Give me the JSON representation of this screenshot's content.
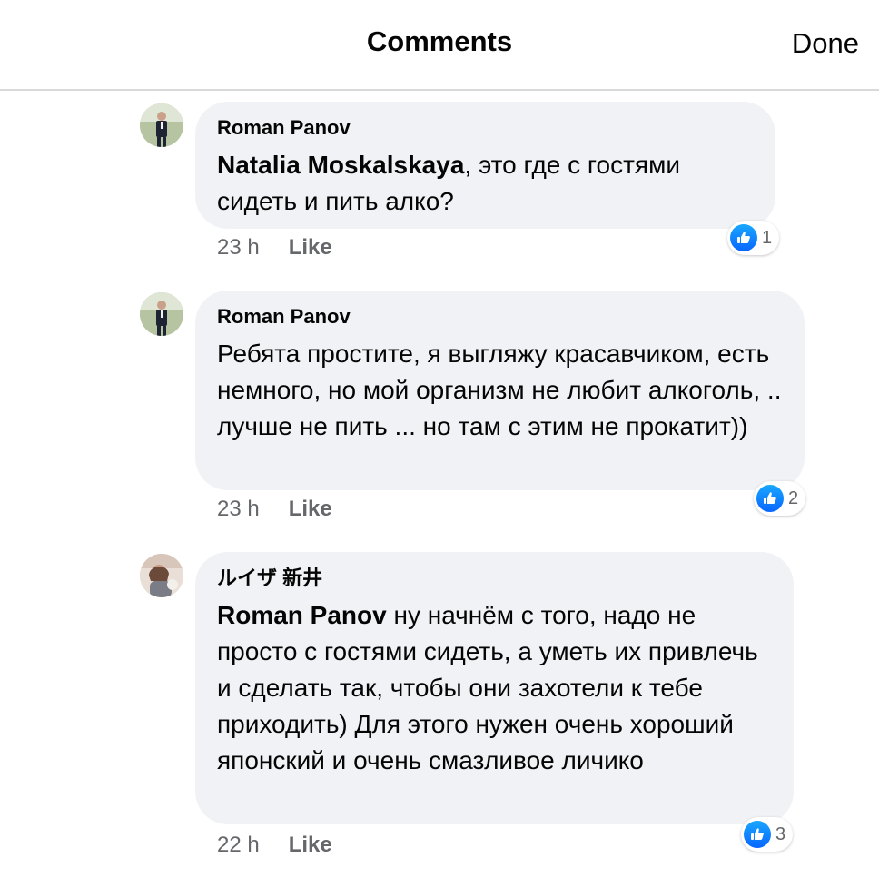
{
  "header": {
    "title": "Comments",
    "done_label": "Done"
  },
  "comments": [
    {
      "author": "Roman Panov",
      "mention": "Natalia Moskalskaya",
      "text": ", это где с гостями сидеть и пить алко?",
      "time": "23 h",
      "like_label": "Like",
      "reaction_count": "1",
      "avatar_icon": "profile-photo-man-in-suit"
    },
    {
      "author": "Roman Panov",
      "mention": "",
      "text": "Ребята простите, я выгляжу красавчиком, есть немного, но мой организм не любит алкоголь, .. лучше не пить ... но там с этим не прокатит))",
      "time": "23 h",
      "like_label": "Like",
      "reaction_count": "2",
      "avatar_icon": "profile-photo-man-in-suit"
    },
    {
      "author": "ルイザ 新井",
      "mention": "Roman Panov",
      "text": " ну начнём с того, надо не просто с гостями сидеть, а уметь их привлечь и сделать так, чтобы они захотели к тебе приходить) Для этого нужен очень хороший японский и очень смазливое личико",
      "time": "22 h",
      "like_label": "Like",
      "reaction_count": "3",
      "avatar_icon": "profile-photo-woman"
    }
  ],
  "colors": {
    "bubble": "#f0f2f5",
    "meta_text": "#65676b",
    "like_blue": "#0866ff",
    "divider": "#d9d9dc"
  }
}
